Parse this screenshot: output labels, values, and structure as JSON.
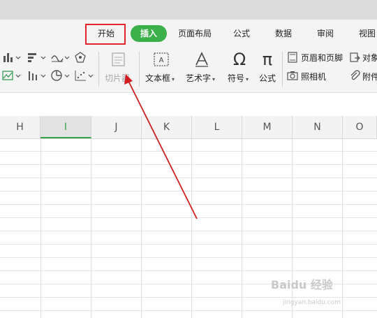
{
  "tabs": {
    "start": "开始",
    "insert": "插入",
    "page_layout": "页面布局",
    "formula": "公式",
    "data": "数据",
    "review": "审阅",
    "view": "视图"
  },
  "ribbon": {
    "slicer": "切片器",
    "textbox": "文本框",
    "wordart": "艺术字",
    "symbol": "符号",
    "equation": "公式",
    "header_footer": "页眉和页脚",
    "object": "对象",
    "camera": "照相机",
    "attachment": "附件"
  },
  "columns": [
    "H",
    "I",
    "J",
    "K",
    "L",
    "M",
    "N",
    "O"
  ],
  "selected_column": "I",
  "watermark": {
    "brand": "Baidu 经验",
    "url": "jingyan.baidu.com"
  },
  "colors": {
    "accent": "#3bb04b",
    "highlight_box": "#e3262b",
    "arrow": "#d11f1f"
  }
}
